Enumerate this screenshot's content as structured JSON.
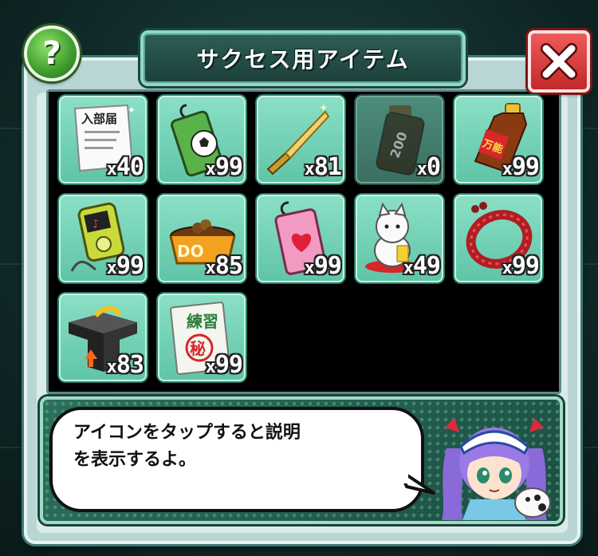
{
  "title": "サクセス用アイテム",
  "help_button_label": "?",
  "message": {
    "line1": "アイコンをタップすると説明",
    "line2": "を表示するよ。"
  },
  "items": [
    {
      "icon": "club-application-form-icon",
      "count_prefix": "x",
      "count": "40",
      "label": "入部届"
    },
    {
      "icon": "soccer-charm-icon",
      "count_prefix": "x",
      "count": "99"
    },
    {
      "icon": "golden-knife-icon",
      "count_prefix": "x",
      "count": "81"
    },
    {
      "icon": "energy-drink-bottle-icon",
      "count_prefix": "x",
      "count": "0",
      "disabled": true
    },
    {
      "icon": "all-purpose-drink-icon",
      "count_prefix": "x",
      "count": "99",
      "label": "万能"
    },
    {
      "icon": "music-player-icon",
      "count_prefix": "x",
      "count": "99"
    },
    {
      "icon": "dog-food-bowl-icon",
      "count_prefix": "x",
      "count": "85",
      "label": "DO"
    },
    {
      "icon": "heart-charm-icon",
      "count_prefix": "x",
      "count": "99"
    },
    {
      "icon": "lucky-cat-icon",
      "count_prefix": "x",
      "count": "49"
    },
    {
      "icon": "red-bracelet-icon",
      "count_prefix": "x",
      "count": "99"
    },
    {
      "icon": "level-up-box-icon",
      "count_prefix": "x",
      "count": "83"
    },
    {
      "icon": "secret-training-book-icon",
      "count_prefix": "x",
      "count": "99",
      "label_top": "練習",
      "label_stamp": "秘"
    }
  ],
  "colors": {
    "tile": "#6fd1b4",
    "panel": "#b9d6d4",
    "close": "#d93b3b",
    "help": "#4fae36"
  }
}
